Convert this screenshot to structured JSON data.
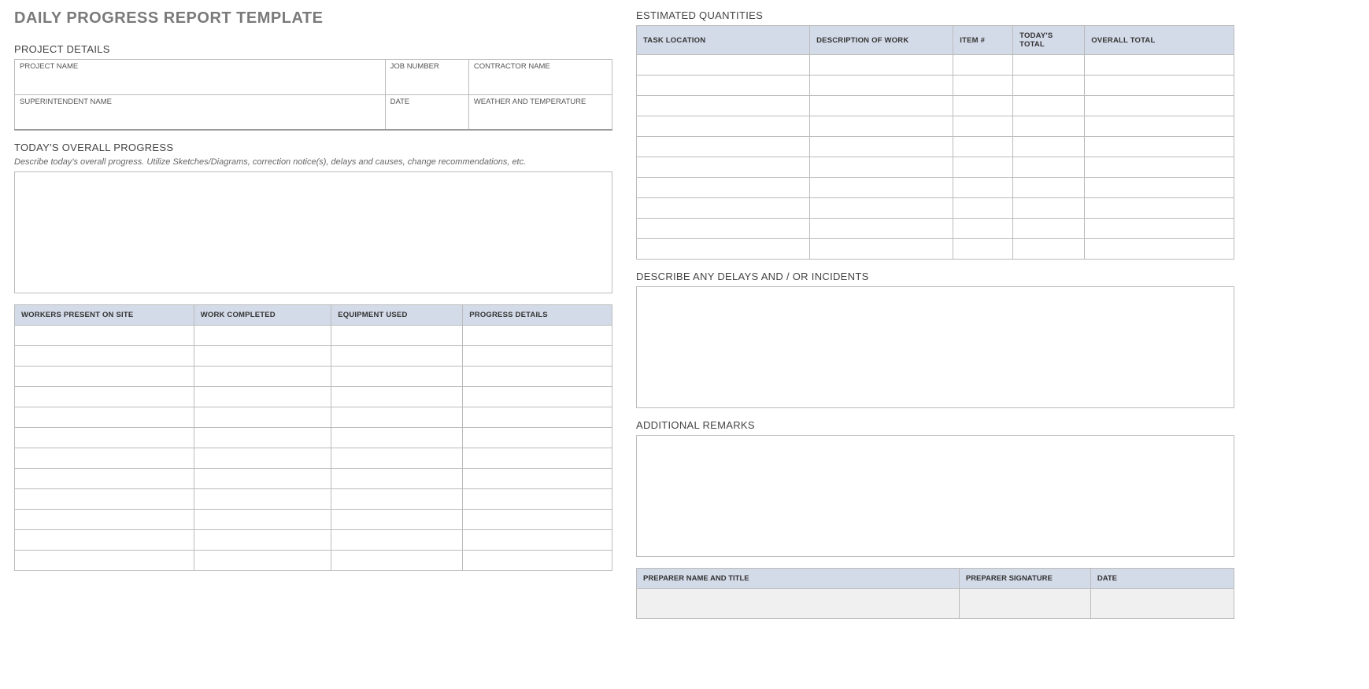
{
  "title": "DAILY PROGRESS REPORT TEMPLATE",
  "left": {
    "project_details_heading": "PROJECT DETAILS",
    "fields_row1": {
      "project_name": "PROJECT NAME",
      "job_number": "JOB NUMBER",
      "contractor_name": "CONTRACTOR NAME"
    },
    "fields_row2": {
      "superintendent_name": "SUPERINTENDENT NAME",
      "date": "DATE",
      "weather": "WEATHER AND TEMPERATURE"
    },
    "overall_heading": "TODAY'S OVERALL PROGRESS",
    "overall_instruction": "Describe today's overall progress.  Utilize Sketches/Diagrams, correction notice(s), delays and causes, change recommendations, etc.",
    "progress_headers": {
      "workers": "WORKERS PRESENT ON SITE",
      "work": "WORK COMPLETED",
      "equipment": "EQUIPMENT USED",
      "details": "PROGRESS DETAILS"
    }
  },
  "right": {
    "estimated_heading": "ESTIMATED QUANTITIES",
    "qty_headers": {
      "task_location": "TASK LOCATION",
      "desc": "DESCRIPTION OF WORK",
      "item": "ITEM #",
      "today_total": "TODAY'S TOTAL",
      "overall_total": "OVERALL TOTAL"
    },
    "delays_heading": "DESCRIBE ANY DELAYS AND / OR INCIDENTS",
    "remarks_heading": "ADDITIONAL REMARKS",
    "sig_headers": {
      "name": "PREPARER NAME AND TITLE",
      "signature": "PREPARER SIGNATURE",
      "date": "DATE"
    }
  }
}
